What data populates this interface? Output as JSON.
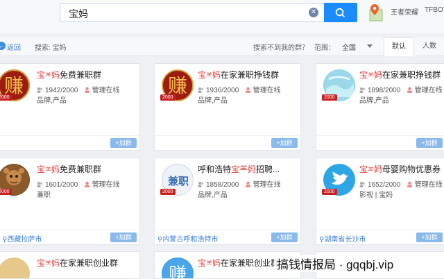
{
  "search": {
    "query": "宝妈"
  },
  "user": {
    "name": "王者荣耀",
    "name2": "TFBOY"
  },
  "toolbar": {
    "back": "返回",
    "search_label": "搜索: 宝妈",
    "not_found": "搜索不到我的群？",
    "range_label": "范围：",
    "range_value": "全国",
    "tabs": [
      "默认",
      "人数"
    ]
  },
  "cards": [
    {
      "title_a": "宝",
      "title_mid": "⺷",
      "title_b": "妈",
      "title_rest": "免费兼职群",
      "members": "1942/2000",
      "admin": "管理在线",
      "tags": "品牌,产品",
      "location": "",
      "join": "+加群",
      "badge": "2000"
    },
    {
      "title_a": "宝",
      "title_mid": "⺷",
      "title_b": "妈",
      "title_rest": "在家兼职挣钱群",
      "members": "1936/2000",
      "admin": "管理在线",
      "tags": "品牌,产品",
      "location": "",
      "join": "+加群",
      "badge": "2000"
    },
    {
      "title_a": "宝",
      "title_mid": "⺷",
      "title_b": "妈",
      "title_rest": "在家兼职挣钱群",
      "members": "1898/2000",
      "admin": "管理在线",
      "tags": "品牌,产品",
      "location": "",
      "join": "+加群",
      "badge": "2000"
    },
    {
      "title_a": "宝",
      "title_mid": "⺷",
      "title_b": "妈",
      "title_rest": "免费兼职群",
      "members": "1601/2000",
      "admin": "管理在线",
      "tags": "兼职",
      "location": "西藏拉萨市",
      "join": "+加群",
      "badge": "2000"
    },
    {
      "title_a": "呼和浩特",
      "title_mid": "宝⺷",
      "title_b": "妈",
      "title_rest": "招聘...",
      "members": "1858/2000",
      "admin": "管理在线",
      "tags": "品牌,产品",
      "location": "内蒙古呼和浩特市",
      "join": "+加群",
      "badge": "2000"
    },
    {
      "title_a": "宝",
      "title_mid": "⺷",
      "title_b": "妈",
      "title_rest": "母婴购物优惠券",
      "members": "1652/2000",
      "admin": "管理在线",
      "tags": "影视 | 宝妈",
      "location": "湖南省长沙市",
      "join": "+加群",
      "badge": "2000"
    },
    {
      "title_a": "宝",
      "title_mid": "⺷",
      "title_b": "妈",
      "title_rest": "在家兼职创业群",
      "members": "",
      "admin": "",
      "tags": "",
      "location": "",
      "join": "",
      "badge": ""
    },
    {
      "title_a": "宝",
      "title_mid": "⺷",
      "title_b": "妈",
      "title_rest": "在家兼职创业群",
      "members": "",
      "admin": "",
      "tags": "",
      "location": "",
      "join": "",
      "badge": ""
    }
  ],
  "avatar_text": {
    "zhuan": "赚",
    "jian": "兼职"
  },
  "watermark": "搞钱情报局 · gqqbj.vip"
}
